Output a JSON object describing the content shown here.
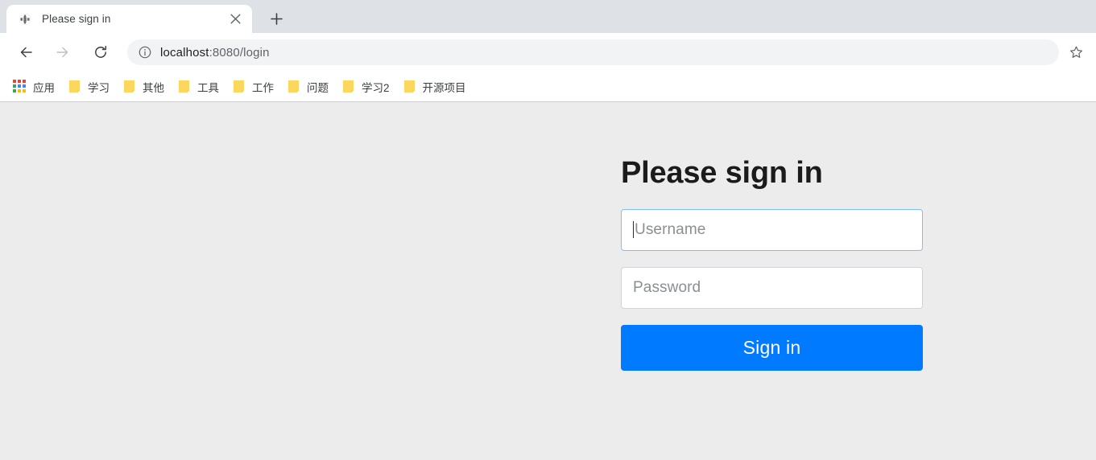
{
  "browser": {
    "tab": {
      "title": "Please sign in",
      "favicon_icon": "globe-icon",
      "close_icon": "close-icon"
    },
    "new_tab_icon": "plus-icon",
    "nav": {
      "back_icon": "arrow-left-icon",
      "forward_icon": "arrow-right-icon",
      "reload_icon": "reload-icon"
    },
    "omnibox": {
      "info_icon": "info-circle-icon",
      "url_host": "localhost",
      "url_rest": ":8080/login",
      "star_icon": "star-outline-icon"
    },
    "bookmarks": [
      {
        "label": "应用",
        "icon": "apps-grid-icon"
      },
      {
        "label": "学习",
        "icon": "folder-icon"
      },
      {
        "label": "其他",
        "icon": "folder-icon"
      },
      {
        "label": "工具",
        "icon": "folder-icon"
      },
      {
        "label": "工作",
        "icon": "folder-icon"
      },
      {
        "label": "问题",
        "icon": "folder-icon"
      },
      {
        "label": "学习2",
        "icon": "folder-icon"
      },
      {
        "label": "开源项目",
        "icon": "folder-icon"
      }
    ]
  },
  "page": {
    "heading": "Please sign in",
    "username": {
      "placeholder": "Username",
      "value": "",
      "focused": true
    },
    "password": {
      "placeholder": "Password",
      "value": "",
      "focused": false
    },
    "submit_label": "Sign in"
  },
  "colors": {
    "accent": "#007bff",
    "page_background": "#ececec",
    "tabstrip": "#dee1e6",
    "focus_border": "#80bdff",
    "field_border": "#ced4da",
    "folder": "#fbd85d"
  }
}
